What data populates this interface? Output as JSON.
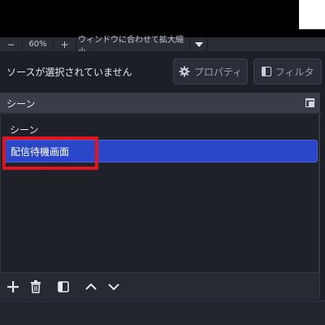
{
  "zoombar": {
    "minus": "−",
    "zoom_percent": "60%",
    "plus": "+",
    "scale_mode": "ウィンドウに合わせて拡大縮小"
  },
  "sources": {
    "no_source_text": "ソースが選択されていません",
    "properties_label": "プロパティ",
    "filters_label": "フィルタ"
  },
  "scenes_dock": {
    "title": "シーン",
    "items": [
      {
        "label": "シーン",
        "selected": false
      },
      {
        "label": "配信待機画面",
        "selected": true
      }
    ]
  },
  "colors": {
    "selection": "#2b46c6",
    "highlight_annotation": "#e2141c"
  },
  "icons": [
    "float-dock-icon",
    "gear-icon",
    "filter-icon",
    "add-icon",
    "trash-icon",
    "filter-scene-icon",
    "chevron-up-icon",
    "chevron-down-icon"
  ]
}
